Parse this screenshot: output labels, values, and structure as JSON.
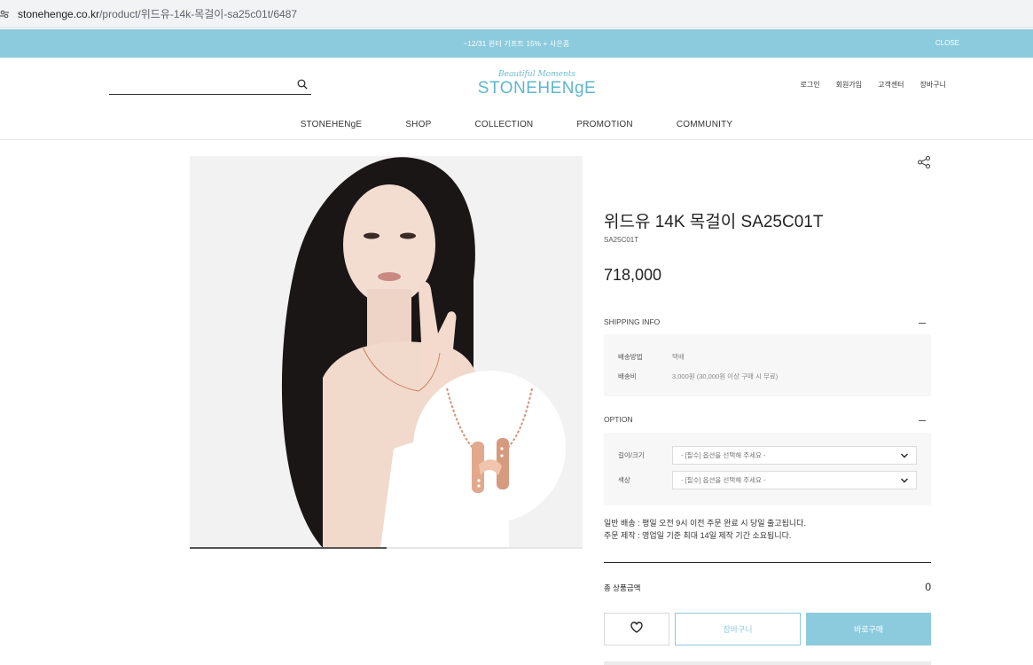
{
  "browser": {
    "url_host": "stonehenge.co.kr",
    "url_path": "/product/위드유-14k-목걸이-sa25c01t/6487"
  },
  "promo": {
    "text": "~12/31 윈터 기프트 15% + 사은품",
    "close_label": "CLOSE"
  },
  "header": {
    "logo_tagline": "Beautiful Moments",
    "logo_brand": "STONEHENgE",
    "search_placeholder": "",
    "util_links": [
      "로그인",
      "회원가입",
      "고객센터",
      "장바구니"
    ],
    "nav": [
      "STONEHENgE",
      "SHOP",
      "COLLECTION",
      "PROMOTION",
      "COMMUNITY"
    ]
  },
  "product": {
    "title": "위드유 14K 목걸이 SA25C01T",
    "code": "SA25C01T",
    "price": "718,000",
    "image_progress": 0.5
  },
  "shipping": {
    "heading": "SHIPPING INFO",
    "rows": [
      {
        "label": "배송방법",
        "value": "택배"
      },
      {
        "label": "배송비",
        "value": "3,000원 (30,000원 이상 구매 시 무료)"
      }
    ]
  },
  "option": {
    "heading": "OPTION",
    "rows": [
      {
        "label": "길이/크기",
        "value": "- [필수] 옵션을 선택해 주세요 -"
      },
      {
        "label": "색상",
        "value": "- [필수] 옵션을 선택해 주세요 -"
      }
    ]
  },
  "notice": {
    "line1": "일반 배송 : 평일 오전 9시 이전 주문 완료 시 당일 출고됩니다.",
    "line2": "주문 제작 : 영업일 기준 최대 14일 제작 기간 소요됩니다."
  },
  "total": {
    "label": "총 상품금액",
    "value": "0"
  },
  "buttons": {
    "cart": "장바구니",
    "buy": "바로구매"
  },
  "colors": {
    "accent": "#8ccbdd",
    "logo": "#5fb6cb"
  },
  "icons": [
    "site-settings-icon",
    "search-icon",
    "share-icon",
    "heart-icon",
    "chevron-down-icon"
  ]
}
